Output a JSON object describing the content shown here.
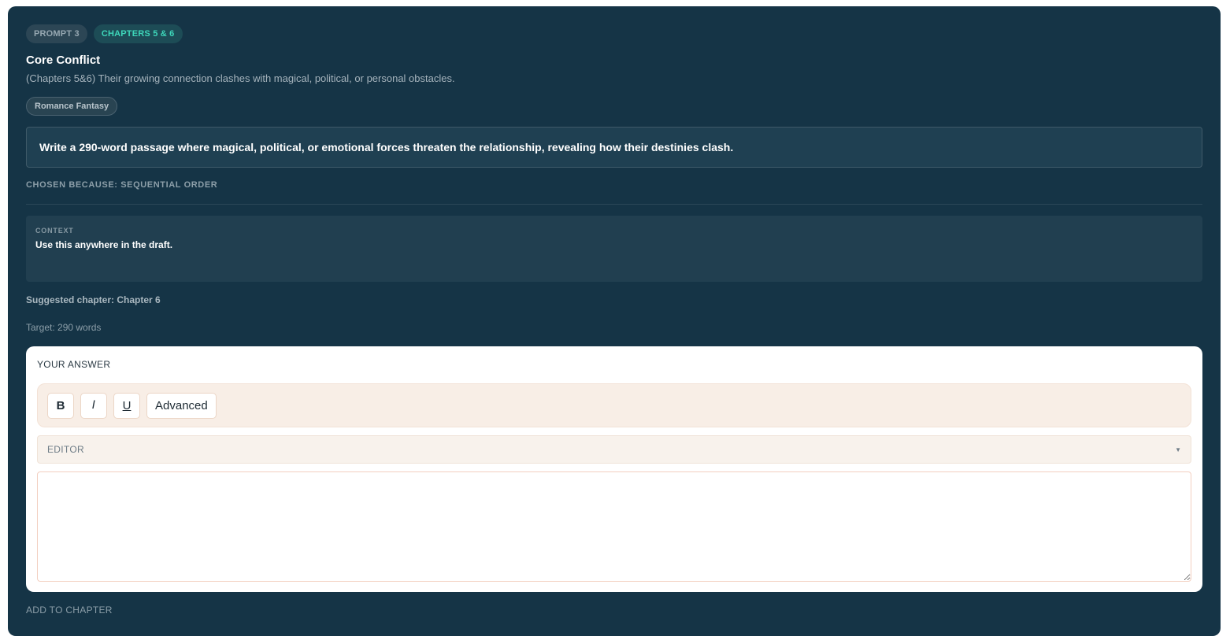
{
  "pills": {
    "prompt": "PROMPT 3",
    "chapters": "CHAPTERS 5 & 6"
  },
  "title": "Core Conflict",
  "subtitle": "(Chapters 5&6) Their growing connection clashes with magical, political, or personal obstacles.",
  "genre_tag": "Romance Fantasy",
  "instruction": "Write a 290-word passage where magical, political, or emotional forces threaten the relationship, revealing how their destinies clash.",
  "chosen_because": "CHOSEN BECAUSE: SEQUENTIAL ORDER",
  "context": {
    "label": "CONTEXT",
    "text": "Use this anywhere in the draft."
  },
  "suggested_chapter": "Suggested chapter: Chapter 6",
  "target": "Target: 290 words",
  "answer": {
    "label": "YOUR ANSWER",
    "toolbar": {
      "bold": "B",
      "italic": "I",
      "underline": "U",
      "advanced": "Advanced"
    },
    "editor_select": "EDITOR",
    "text_value": ""
  },
  "add_to_chapter": "ADD TO CHAPTER",
  "colors": {
    "card_bg": "#153446",
    "accent_teal": "#3ed7ba",
    "toolbar_bg": "#f8eee6"
  }
}
